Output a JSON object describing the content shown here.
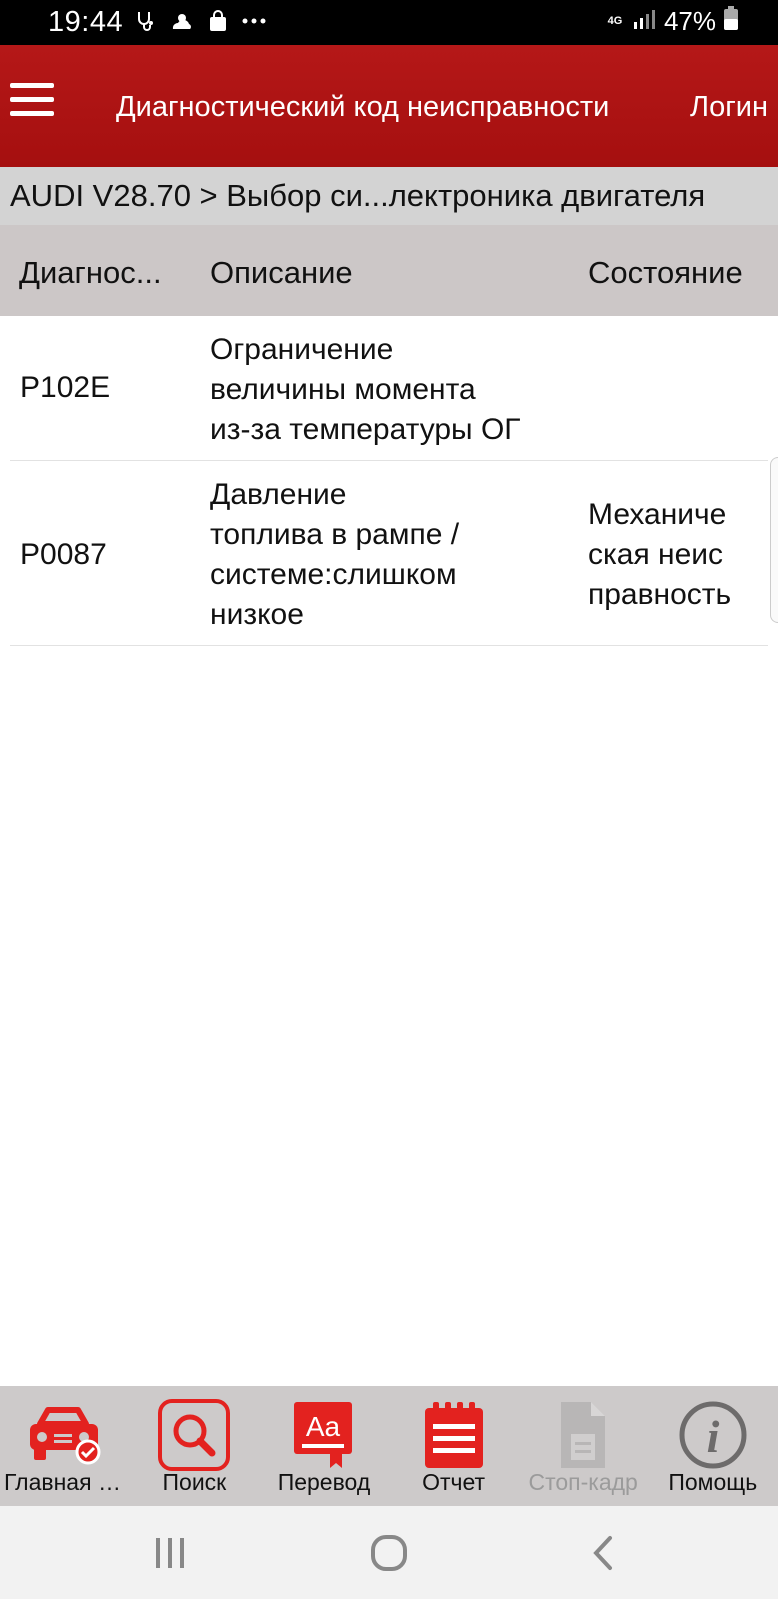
{
  "status_bar": {
    "time": "19:44",
    "network": "4G",
    "battery": "47%",
    "icons": [
      "stethoscope-icon",
      "weather-icon",
      "shopping-bag-icon",
      "more-dots-icon",
      "signal-icon",
      "battery-icon"
    ]
  },
  "header": {
    "title": "Диагностический код неисправности",
    "login_label": "Логин"
  },
  "breadcrumb": "AUDI V28.70 > Выбор си...лектроника двигателя",
  "table": {
    "columns": [
      "Диагнос...",
      "Описание",
      "Состояние"
    ],
    "rows": [
      {
        "code": "P102E",
        "description": [
          "Ограничение",
          "величины момента",
          "из-за температуры ОГ"
        ],
        "state": []
      },
      {
        "code": "P0087",
        "description": [
          "Давление",
          "топлива в рампе /",
          "системе:слишком",
          "низкое"
        ],
        "state": [
          "Механиче",
          "ская неис",
          "правность"
        ]
      }
    ]
  },
  "toolbar": {
    "items": [
      {
        "label": "Главная с...",
        "icon": "car-check-icon",
        "enabled": true
      },
      {
        "label": "Поиск",
        "icon": "search-icon",
        "enabled": true
      },
      {
        "label": "Перевод",
        "icon": "translate-icon",
        "enabled": true
      },
      {
        "label": "Отчет",
        "icon": "report-icon",
        "enabled": true
      },
      {
        "label": "Стоп-кадр",
        "icon": "freeze-frame-icon",
        "enabled": false
      },
      {
        "label": "Помощь",
        "icon": "info-icon",
        "enabled": true
      }
    ]
  },
  "colors": {
    "header_red": "#a50f0f",
    "icon_red": "#e3221f",
    "breadcrumb_bg": "#d3d3d3",
    "table_head_bg": "#ccc7c7",
    "toolbar_bg": "#cdcaca",
    "disabled_gray": "#9b9b9b"
  }
}
